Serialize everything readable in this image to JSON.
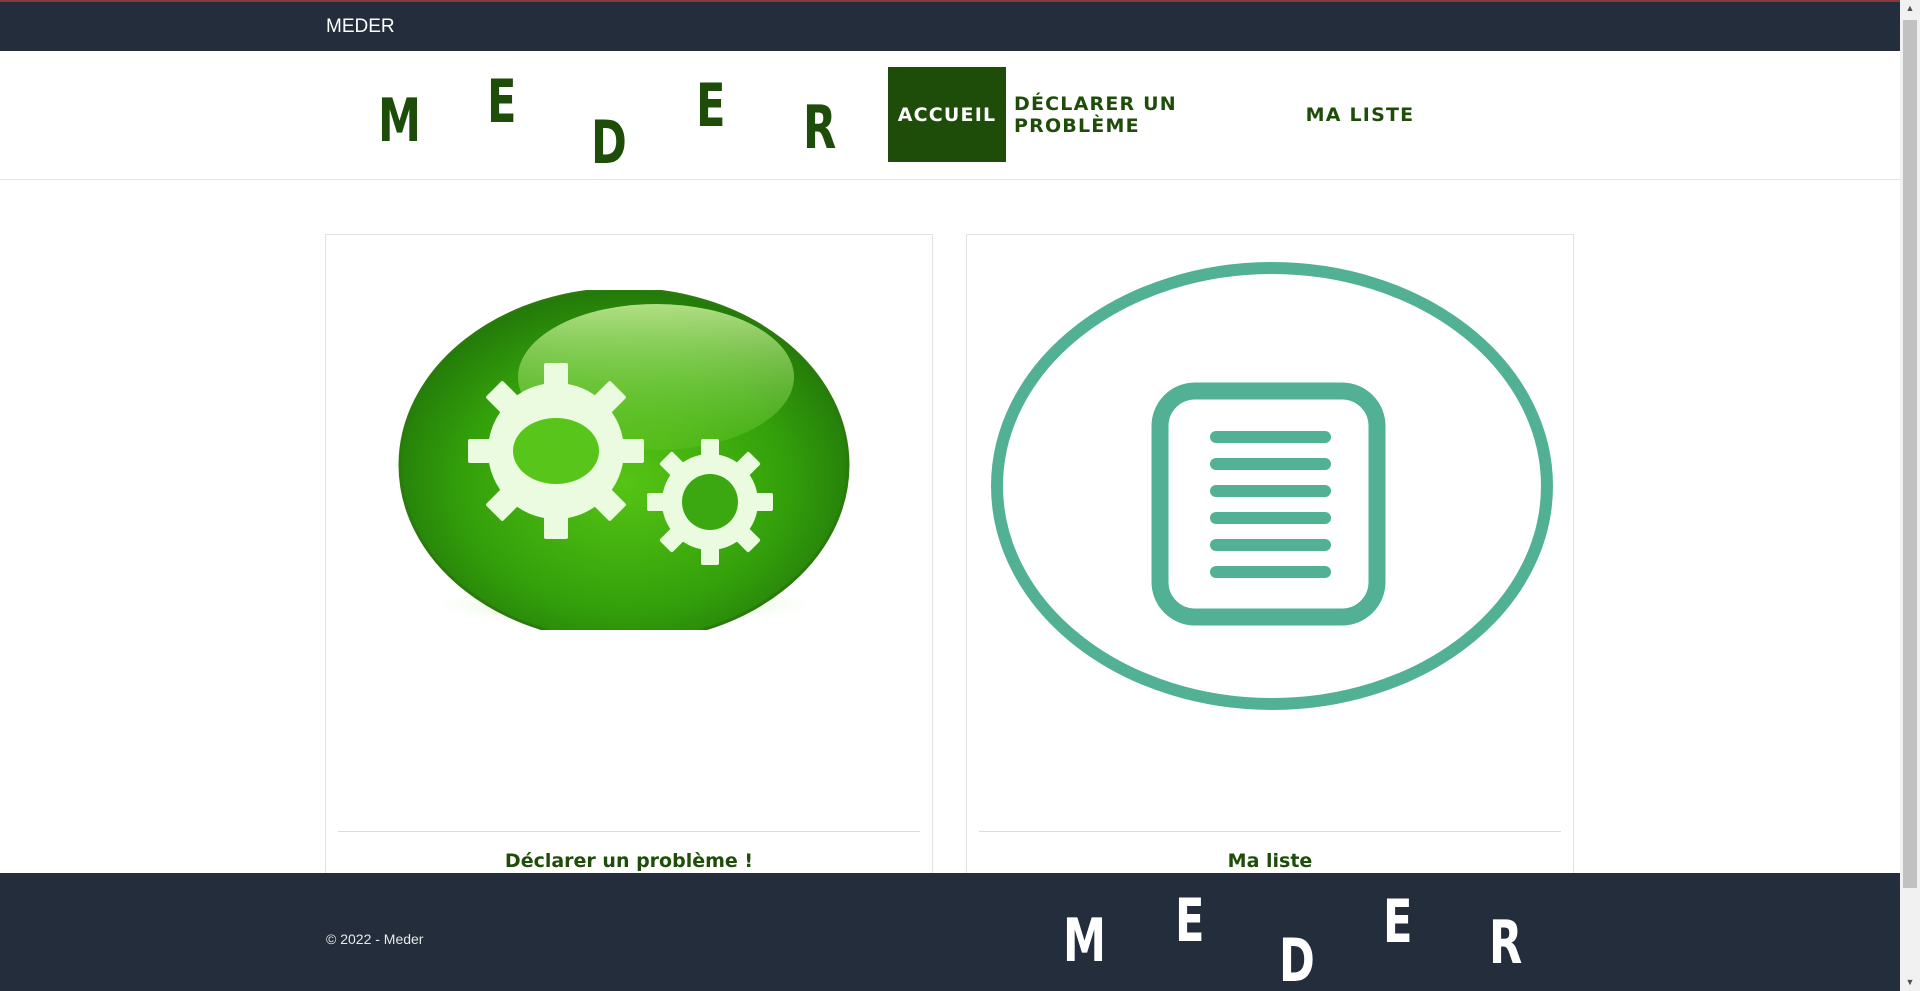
{
  "topbar": {
    "title": "MEDER"
  },
  "logo": {
    "letters": [
      "M",
      "E",
      "D",
      "E",
      "R"
    ]
  },
  "nav": {
    "items": [
      {
        "label": "Accueil",
        "active": true
      },
      {
        "label": "Déclarer un problème",
        "active": false
      },
      {
        "label": "Ma liste",
        "active": false
      }
    ]
  },
  "cards": [
    {
      "label": "Déclarer un problème !",
      "icon": "gears-icon"
    },
    {
      "label": "Ma liste",
      "icon": "document-list-icon"
    }
  ],
  "footer": {
    "copyright": "© 2022 - Meder"
  },
  "colors": {
    "brand_green": "#1e4d0a",
    "dark_navy": "#232d3b",
    "list_teal": "#52b194",
    "gear_green": "#3aa60f"
  }
}
